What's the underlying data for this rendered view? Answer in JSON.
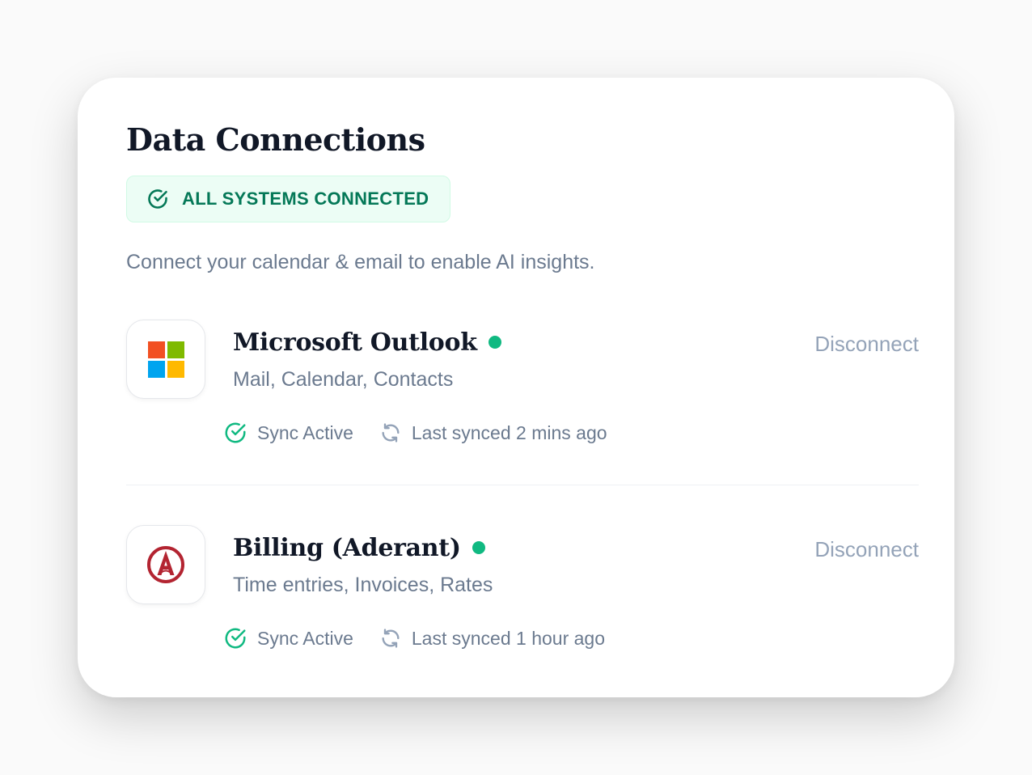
{
  "title": "Data Connections",
  "status_badge": {
    "label": "ALL SYSTEMS CONNECTED",
    "icon": "check-circle-icon",
    "color": "#047857",
    "background": "#ecfdf5"
  },
  "subtitle": "Connect your calendar & email to enable AI insights.",
  "connections": [
    {
      "name": "Microsoft Outlook",
      "logo": "microsoft-logo",
      "logo_colors": [
        "#f25022",
        "#7fba00",
        "#00a4ef",
        "#ffb900"
      ],
      "connected": true,
      "description": "Mail, Calendar, Contacts",
      "sync_status": "Sync Active",
      "last_synced": "Last synced 2 mins ago",
      "action": "Disconnect"
    },
    {
      "name": "Billing (Aderant)",
      "logo": "aderant-logo",
      "logo_colors": [
        "#b32431"
      ],
      "connected": true,
      "description": "Time entries, Invoices, Rates",
      "sync_status": "Sync Active",
      "last_synced": "Last synced 1 hour ago",
      "action": "Disconnect"
    }
  ],
  "colors": {
    "accent_green": "#10b981",
    "text_dark": "#111827",
    "text_muted": "#6b7a8f",
    "action_muted": "#94a3b8"
  }
}
